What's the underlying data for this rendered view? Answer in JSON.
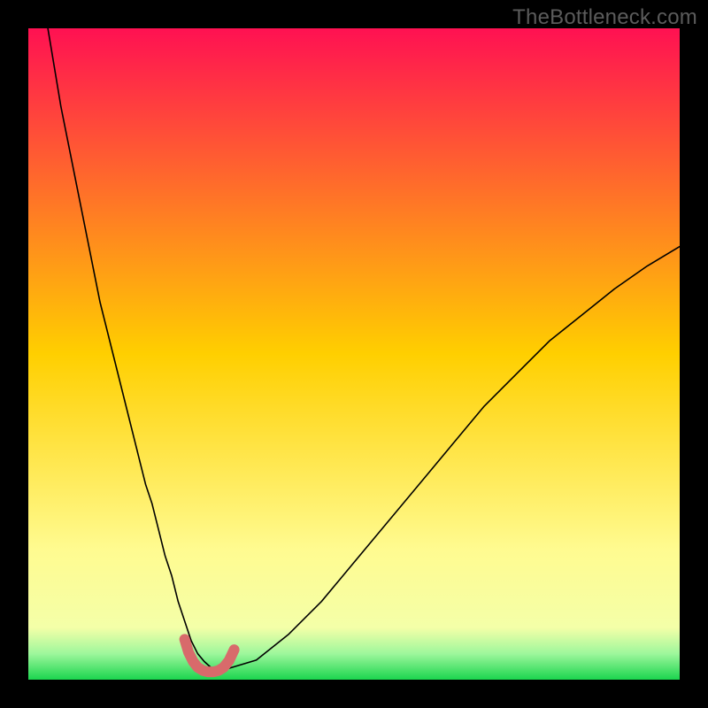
{
  "watermark": "TheBottleneck.com",
  "chart_data": {
    "type": "line",
    "title": "",
    "xlabel": "",
    "ylabel": "",
    "xlim": [
      0,
      100
    ],
    "ylim": [
      0,
      100
    ],
    "grid": false,
    "legend": false,
    "gradient_stops": [
      {
        "offset": 0.0,
        "color": "#ff1152"
      },
      {
        "offset": 0.5,
        "color": "#ffcf00"
      },
      {
        "offset": 0.8,
        "color": "#fffb90"
      },
      {
        "offset": 0.92,
        "color": "#f4ffa8"
      },
      {
        "offset": 0.96,
        "color": "#9ef79c"
      },
      {
        "offset": 1.0,
        "color": "#1bd54e"
      }
    ],
    "series": [
      {
        "name": "bottleneck-curve",
        "color": "#000000",
        "stroke_width": 1.6,
        "x": [
          3,
          4,
          5,
          6,
          7,
          8,
          9,
          10,
          11,
          12,
          13,
          14,
          15,
          16,
          17,
          18,
          19,
          20,
          21,
          22,
          23,
          24,
          25,
          26,
          27,
          28,
          29,
          30,
          35,
          40,
          45,
          50,
          55,
          60,
          65,
          70,
          75,
          80,
          85,
          90,
          95,
          100
        ],
        "y": [
          100,
          94,
          88,
          83,
          78,
          73,
          68,
          63,
          58,
          54,
          50,
          46,
          42,
          38,
          34,
          30,
          27,
          23,
          19,
          16,
          12,
          9,
          6,
          4,
          2.8,
          1.9,
          1.4,
          1.5,
          3.0,
          7.0,
          12,
          18,
          24,
          30,
          36,
          42,
          47,
          52,
          56,
          60,
          63.5,
          66.5
        ]
      },
      {
        "name": "optimal-trough-highlight",
        "color": "#d86a6b",
        "stroke_width": 12,
        "x": [
          24.0,
          24.6,
          25.3,
          26.0,
          26.8,
          27.6,
          28.4,
          29.2,
          30.0,
          30.8,
          31.6
        ],
        "y": [
          6.2,
          4.2,
          2.8,
          1.9,
          1.4,
          1.2,
          1.2,
          1.4,
          1.9,
          2.9,
          4.6
        ]
      }
    ]
  }
}
